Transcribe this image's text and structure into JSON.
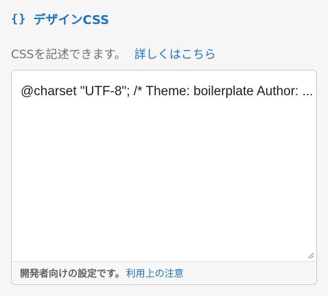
{
  "header": {
    "icon_text": "{}",
    "title": "デザインCSS"
  },
  "description": {
    "text": "CSSを記述できます。",
    "link_label": "詳しくはこちら"
  },
  "editor": {
    "code": "@charset \"UTF-8\"; /* Theme: boilerplate Author: ...",
    "footer_text": "開発者向けの設定です。",
    "footer_link": "利用上の注意"
  },
  "colors": {
    "accent": "#1a73c7",
    "muted_text": "#6f6f6f",
    "background": "#f6f6f6"
  },
  "icons": {
    "heading": "braces-icon",
    "resize": "resize-handle-icon"
  }
}
